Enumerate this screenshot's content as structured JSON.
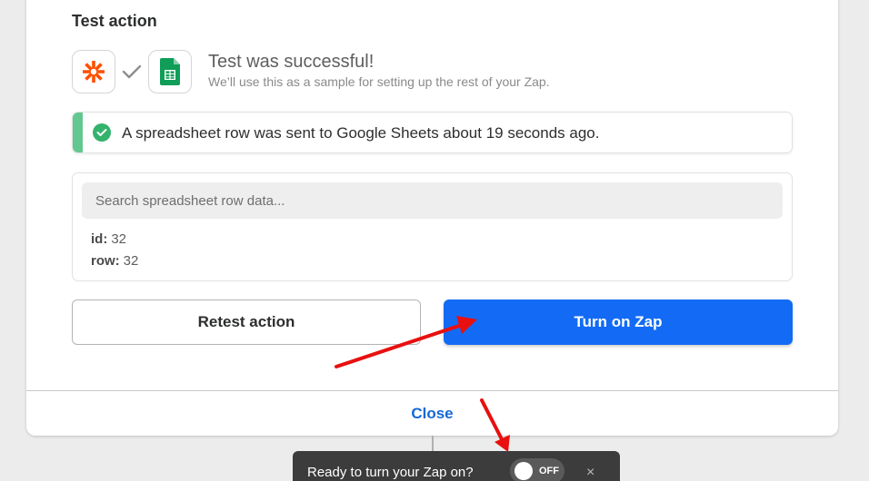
{
  "panel": {
    "title": "Test action",
    "success_title": "Test was successful!",
    "success_subtitle": "We’ll use this as a sample for setting up the rest of your Zap."
  },
  "apps": {
    "trigger_icon": "zapier-asterisk-icon",
    "action_icon": "google-sheets-icon",
    "connector_icon": "check-icon"
  },
  "notice": {
    "text": "A spreadsheet row was sent to Google Sheets about 19 seconds ago."
  },
  "data": {
    "search_placeholder": "Search spreadsheet row data...",
    "fields": [
      {
        "key": "id:",
        "value": "32"
      },
      {
        "key": "row:",
        "value": "32"
      }
    ]
  },
  "buttons": {
    "retest": "Retest action",
    "turn_on": "Turn on Zap",
    "close": "Close"
  },
  "toast": {
    "text": "Ready to turn your Zap on?",
    "toggle_state": "OFF",
    "dismiss": "×"
  },
  "colors": {
    "primary": "#136bf5",
    "success": "#34b36c",
    "zapier_orange": "#ff4f00",
    "sheets_green": "#0f9d58",
    "annotation_arrow": "#e81010"
  }
}
